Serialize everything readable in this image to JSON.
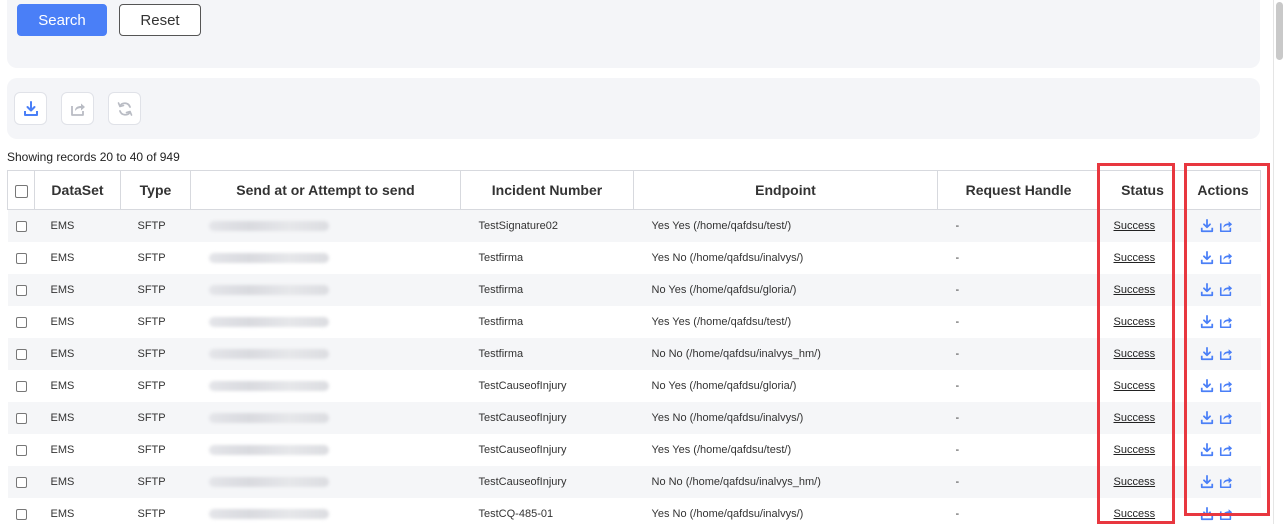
{
  "search": {
    "search_label": "Search",
    "reset_label": "Reset"
  },
  "toolbar": {
    "icons": [
      "download-icon",
      "export-icon",
      "refresh-icon"
    ]
  },
  "records": {
    "showing": "Showing records 20 to 40 of 949"
  },
  "table": {
    "headers": {
      "dataset": "DataSet",
      "type": "Type",
      "send": "Send at or Attempt to send",
      "incident": "Incident Number",
      "endpoint": "Endpoint",
      "request": "Request Handle",
      "status": "Status",
      "actions": "Actions"
    },
    "rows": [
      {
        "dataset": "EMS",
        "type": "SFTP",
        "incident": "TestSignature02",
        "endpoint": "Yes Yes (/home/qafdsu/test/)",
        "request": "-",
        "status": "Success"
      },
      {
        "dataset": "EMS",
        "type": "SFTP",
        "incident": "Testfirma",
        "endpoint": "Yes No (/home/qafdsu/inalvys/)",
        "request": "-",
        "status": "Success"
      },
      {
        "dataset": "EMS",
        "type": "SFTP",
        "incident": "Testfirma",
        "endpoint": "No Yes (/home/qafdsu/gloria/)",
        "request": "-",
        "status": "Success"
      },
      {
        "dataset": "EMS",
        "type": "SFTP",
        "incident": "Testfirma",
        "endpoint": "Yes Yes (/home/qafdsu/test/)",
        "request": "-",
        "status": "Success"
      },
      {
        "dataset": "EMS",
        "type": "SFTP",
        "incident": "Testfirma",
        "endpoint": "No No (/home/qafdsu/inalvys_hm/)",
        "request": "-",
        "status": "Success"
      },
      {
        "dataset": "EMS",
        "type": "SFTP",
        "incident": "TestCauseofInjury",
        "endpoint": "No Yes (/home/qafdsu/gloria/)",
        "request": "-",
        "status": "Success"
      },
      {
        "dataset": "EMS",
        "type": "SFTP",
        "incident": "TestCauseofInjury",
        "endpoint": "Yes No (/home/qafdsu/inalvys/)",
        "request": "-",
        "status": "Success"
      },
      {
        "dataset": "EMS",
        "type": "SFTP",
        "incident": "TestCauseofInjury",
        "endpoint": "Yes Yes (/home/qafdsu/test/)",
        "request": "-",
        "status": "Success"
      },
      {
        "dataset": "EMS",
        "type": "SFTP",
        "incident": "TestCauseofInjury",
        "endpoint": "No No (/home/qafdsu/inalvys_hm/)",
        "request": "-",
        "status": "Success"
      },
      {
        "dataset": "EMS",
        "type": "SFTP",
        "incident": "TestCQ-485-01",
        "endpoint": "Yes No (/home/qafdsu/inalvys/)",
        "request": "-",
        "status": "Success"
      }
    ]
  },
  "colors": {
    "accent": "#4a7ff7",
    "highlight": "#e8373f",
    "icon": "#4a7ff7"
  }
}
